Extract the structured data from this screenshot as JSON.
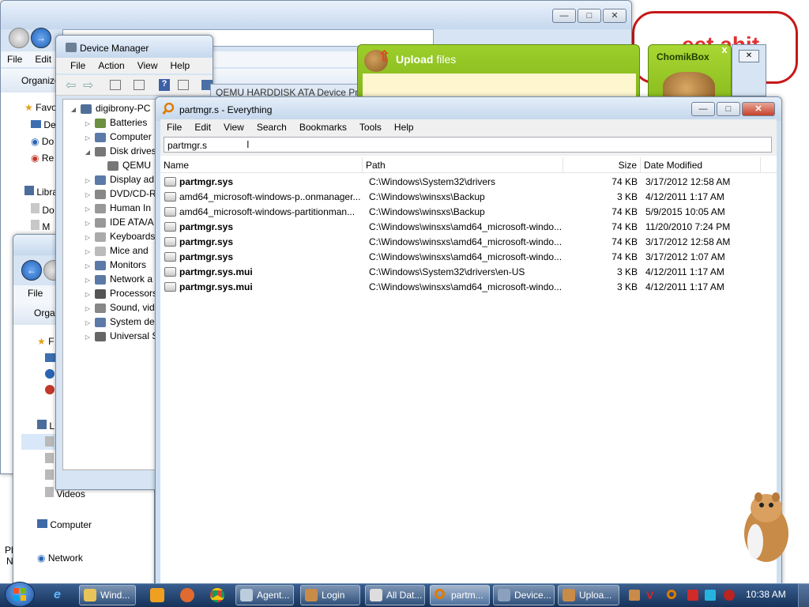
{
  "desktop": {
    "watermark_text": "eet ahit",
    "left_edge_text": [
      "Pl",
      "N"
    ]
  },
  "explorer_back": {
    "menu": [
      "File",
      "Edit"
    ],
    "organize": "Organize",
    "nav": [
      "Favo",
      "De",
      "Do",
      "Re",
      "Libra",
      "Do",
      "M"
    ]
  },
  "explorer_front": {
    "menu": [
      "File"
    ],
    "organize": "Orga",
    "nav": [
      "F",
      "L",
      "Videos",
      "Computer",
      "Network"
    ]
  },
  "device_manager": {
    "title": "Device Manager",
    "menu": [
      "File",
      "Action",
      "View",
      "Help"
    ],
    "tooltip": "QEMU HARDDISK ATA Device Pro",
    "root": "digibrony-PC",
    "items": [
      "Batteries",
      "Computer",
      "Disk drives",
      "QEMU",
      "Display ad",
      "DVD/CD-R",
      "Human In",
      "IDE ATA/A",
      "Keyboards",
      "Mice and",
      "Monitors",
      "Network a",
      "Processors",
      "Sound, vid",
      "System de",
      "Universal S"
    ]
  },
  "upload": {
    "title_bold": "Upload",
    "title_rest": " files",
    "brand": "ChomikBox",
    "close": "x"
  },
  "everything": {
    "title": "partmgr.s - Everything",
    "menu": [
      "File",
      "Edit",
      "View",
      "Search",
      "Bookmarks",
      "Tools",
      "Help"
    ],
    "search_value": "partmgr.s",
    "columns": [
      "Name",
      "Path",
      "Size",
      "Date Modified"
    ],
    "rows": [
      {
        "name": "partmgr.sys",
        "bold": true,
        "path": "C:\\Windows\\System32\\drivers",
        "size": "74 KB",
        "date": "3/17/2012 12:58 AM"
      },
      {
        "name": "amd64_microsoft-windows-p..onmanager...",
        "bold": false,
        "path": "C:\\Windows\\winsxs\\Backup",
        "size": "3 KB",
        "date": "4/12/2011 1:17 AM"
      },
      {
        "name": "amd64_microsoft-windows-partitionman...",
        "bold": false,
        "path": "C:\\Windows\\winsxs\\Backup",
        "size": "74 KB",
        "date": "5/9/2015 10:05 AM"
      },
      {
        "name": "partmgr.sys",
        "bold": true,
        "path": "C:\\Windows\\winsxs\\amd64_microsoft-windo...",
        "size": "74 KB",
        "date": "11/20/2010 7:24 PM"
      },
      {
        "name": "partmgr.sys",
        "bold": true,
        "path": "C:\\Windows\\winsxs\\amd64_microsoft-windo...",
        "size": "74 KB",
        "date": "3/17/2012 12:58 AM"
      },
      {
        "name": "partmgr.sys",
        "bold": true,
        "path": "C:\\Windows\\winsxs\\amd64_microsoft-windo...",
        "size": "74 KB",
        "date": "3/17/2012 1:07 AM"
      },
      {
        "name": "partmgr.sys.mui",
        "bold": true,
        "path": "C:\\Windows\\System32\\drivers\\en-US",
        "size": "3 KB",
        "date": "4/12/2011 1:17 AM"
      },
      {
        "name": "partmgr.sys.mui",
        "bold": true,
        "path": "C:\\Windows\\winsxs\\amd64_microsoft-windo...",
        "size": "3 KB",
        "date": "4/12/2011 1:17 AM"
      }
    ]
  },
  "taskbar": {
    "items": [
      "Wind...",
      "Agent...",
      "Login",
      "All Dat...",
      "partm...",
      "Device...",
      "Uploa..."
    ],
    "clock": "10:38 AM"
  },
  "colors": {
    "taskbar": "#1c3f6e",
    "accent_green": "#8cbd1f",
    "selection": "#cce4f7"
  }
}
